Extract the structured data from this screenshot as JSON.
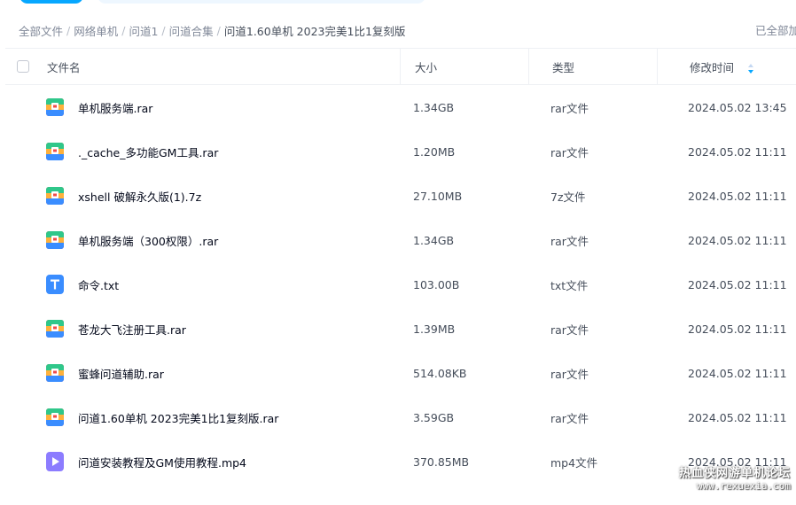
{
  "breadcrumb": {
    "items": [
      "全部文件",
      "网络单机",
      "问道1",
      "问道合集"
    ],
    "current": "问道1.60单机 2023完美1比1复刻版",
    "separator": "/"
  },
  "loaded_note": "已全部加载",
  "columns": {
    "name": "文件名",
    "size": "大小",
    "type": "类型",
    "modified": "修改时间"
  },
  "sort": {
    "column": "modified",
    "direction": "desc"
  },
  "files": [
    {
      "icon": "rar-archive-icon",
      "name": "单机服务端.rar",
      "size": "1.34GB",
      "type": "rar文件",
      "modified": "2024.05.02 13:45"
    },
    {
      "icon": "rar-archive-icon",
      "name": "._cache_多功能GM工具.rar",
      "size": "1.20MB",
      "type": "rar文件",
      "modified": "2024.05.02 11:11"
    },
    {
      "icon": "rar-archive-icon",
      "name": "xshell 破解永久版(1).7z",
      "size": "27.10MB",
      "type": "7z文件",
      "modified": "2024.05.02 11:11"
    },
    {
      "icon": "rar-archive-icon",
      "name": "单机服务端（300权限）.rar",
      "size": "1.34GB",
      "type": "rar文件",
      "modified": "2024.05.02 11:11"
    },
    {
      "icon": "text-file-icon",
      "name": "命令.txt",
      "size": "103.00B",
      "type": "txt文件",
      "modified": "2024.05.02 11:11"
    },
    {
      "icon": "rar-archive-icon",
      "name": "苍龙大飞注册工具.rar",
      "size": "1.39MB",
      "type": "rar文件",
      "modified": "2024.05.02 11:11"
    },
    {
      "icon": "rar-archive-icon",
      "name": "蜜蜂问道辅助.rar",
      "size": "514.08KB",
      "type": "rar文件",
      "modified": "2024.05.02 11:11"
    },
    {
      "icon": "rar-archive-icon",
      "name": "问道1.60单机 2023完美1比1复刻版.rar",
      "size": "3.59GB",
      "type": "rar文件",
      "modified": "2024.05.02 11:11"
    },
    {
      "icon": "video-file-icon",
      "name": "问道安装教程及GM使用教程.mp4",
      "size": "370.85MB",
      "type": "mp4文件",
      "modified": "2024.05.02 11:11"
    }
  ],
  "watermark": {
    "line1": "热血侠网游单机论坛",
    "line2": "www.rexuexia.com"
  },
  "colors": {
    "accent": "#06a7ff",
    "text": "#03081a",
    "muted": "#818999",
    "rar": "#ef4b4b",
    "txt": "#3a8dff",
    "video": "#8c7cff"
  }
}
